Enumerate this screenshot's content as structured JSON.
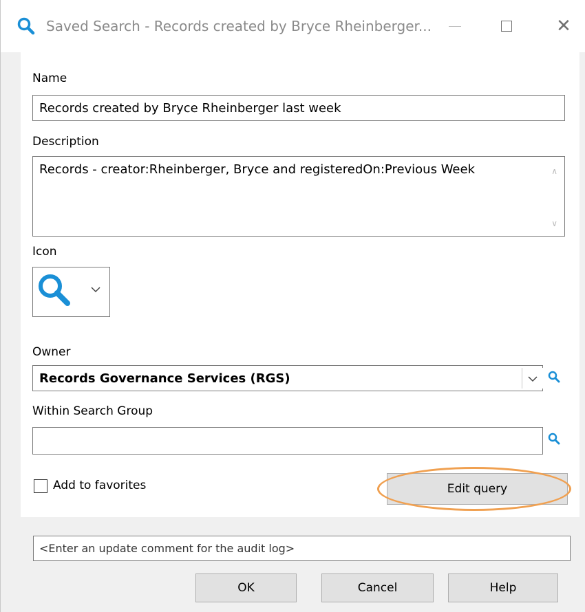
{
  "window": {
    "title": "Saved Search - Records created by Bryce Rheinberger...",
    "accent_color": "#1a8fd6",
    "highlight_color": "#f0a050"
  },
  "form": {
    "name_label": "Name",
    "name_value": "Records created by Bryce Rheinberger last week",
    "description_label": "Description",
    "description_value": "Records - creator:Rheinberger, Bryce and registeredOn:Previous Week",
    "icon_label": "Icon",
    "icon_selected": "search-icon",
    "owner_label": "Owner",
    "owner_value": "Records Governance Services (RGS)",
    "group_label": "Within Search Group",
    "group_value": "",
    "favorites_label": "Add to favorites",
    "favorites_checked": false,
    "edit_query_label": "Edit query"
  },
  "footer": {
    "audit_placeholder": "<Enter an update comment for the audit log>",
    "ok_label": "OK",
    "cancel_label": "Cancel",
    "help_label": "Help"
  }
}
